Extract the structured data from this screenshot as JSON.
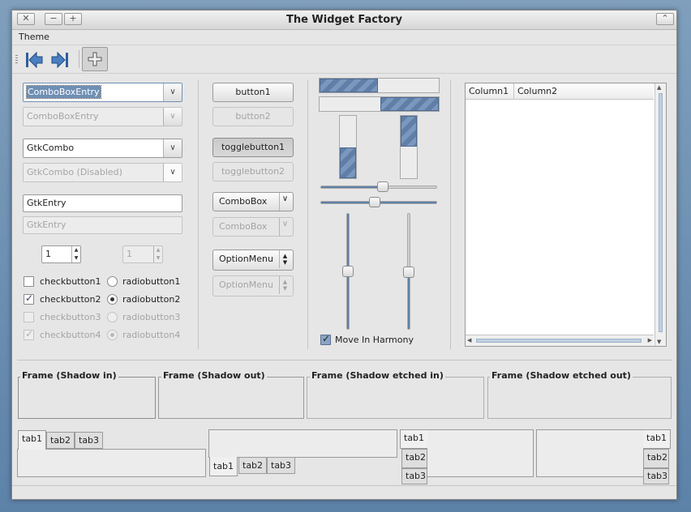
{
  "window": {
    "title": "The Widget Factory",
    "close_glyph": "✕",
    "minimize_glyph": "−",
    "maximize_glyph": "+",
    "shade_glyph": "⌃"
  },
  "menu": {
    "theme": "Theme"
  },
  "toolbar": {
    "items": [
      "go-first-icon",
      "go-last-icon",
      "add-icon"
    ]
  },
  "combos": {
    "entry_active": "ComboBoxEntry",
    "entry_disabled": "ComboBoxEntry",
    "gtkcombo": "GtkCombo",
    "gtkcombo_disabled": "GtkCombo (Disabled)",
    "arrow": "∨"
  },
  "entries": {
    "active": "GtkEntry",
    "disabled": "GtkEntry"
  },
  "spins": {
    "active": "1",
    "disabled": "1",
    "up": "▲",
    "down": "▼"
  },
  "checks": [
    {
      "label": "checkbutton1",
      "checked": false,
      "enabled": true
    },
    {
      "label": "checkbutton2",
      "checked": true,
      "enabled": true
    },
    {
      "label": "checkbutton3",
      "checked": false,
      "enabled": false
    },
    {
      "label": "checkbutton4",
      "checked": true,
      "enabled": false
    }
  ],
  "radios": [
    {
      "label": "radiobutton1",
      "selected": false,
      "enabled": true
    },
    {
      "label": "radiobutton2",
      "selected": true,
      "enabled": true
    },
    {
      "label": "radiobutton3",
      "selected": false,
      "enabled": false
    },
    {
      "label": "radiobutton4",
      "selected": true,
      "enabled": false
    }
  ],
  "buttons": {
    "button1": "button1",
    "button2": "button2",
    "toggle1": "togglebutton1",
    "toggle2": "togglebutton2",
    "combobox1": "ComboBox",
    "combobox2": "ComboBox",
    "option1": "OptionMenu",
    "option2": "OptionMenu"
  },
  "progress": {
    "h1": 0.5,
    "h2": 0.5,
    "v1": 0.5,
    "v2": 0.5
  },
  "sliders": {
    "h1": 0.5,
    "h2": 0.5,
    "v1": 0.5,
    "v2": 0.5
  },
  "harmony": {
    "label": "Move In Harmony",
    "checked": true
  },
  "tree": {
    "columns": [
      "Column1",
      "Column2"
    ]
  },
  "frames": [
    "Frame (Shadow in)",
    "Frame (Shadow out)",
    "Frame (Shadow etched in)",
    "Frame (Shadow etched out)"
  ],
  "notebooks": {
    "tabs": [
      "tab1",
      "tab2",
      "tab3"
    ]
  },
  "colors": {
    "accent": "#5f7fa8",
    "selection": "#6f8fb5"
  }
}
